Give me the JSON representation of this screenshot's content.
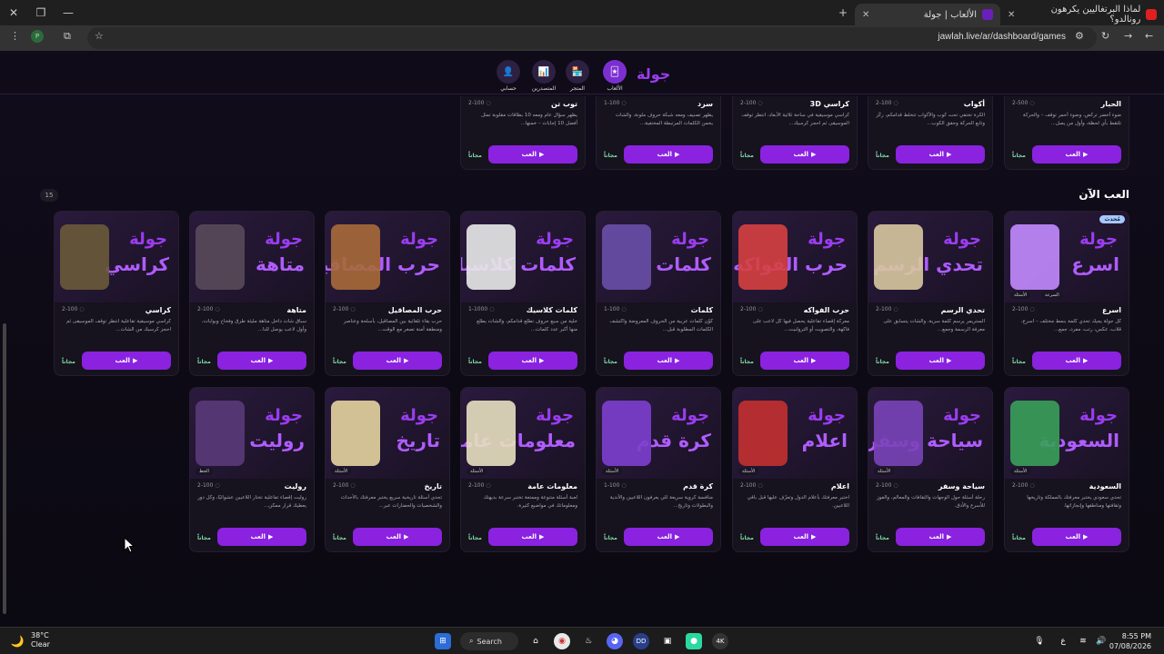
{
  "browser": {
    "tabs": [
      {
        "title": "لماذا البرتغاليين يكرهون رونالدو؟",
        "active": false
      },
      {
        "title": "الألعاب | جولة",
        "active": true
      }
    ],
    "new_tab": "+",
    "url": "jawlah.live/ar/dashboard/games"
  },
  "nav": {
    "logo": "جولة",
    "items": [
      {
        "label": "الألعاب",
        "icon": "game-icon",
        "active": true
      },
      {
        "label": "المتجر",
        "icon": "store-icon",
        "active": false
      },
      {
        "label": "المتصدرين",
        "icon": "leaderboard-icon",
        "active": false
      },
      {
        "label": "حسابي",
        "icon": "profile-icon",
        "active": false
      }
    ]
  },
  "common": {
    "play_label": "العب",
    "free_label": "مجاناً",
    "play_icon": "▶",
    "users_icon": "👥"
  },
  "top_row": [
    {
      "name": "الحبار",
      "players": "2-500",
      "desc": "ضوء أخضر تركض، وضوء أحمر توقف – والحركة تلتقط بأي لحظة، وأول من يصل..."
    },
    {
      "name": "أكواب",
      "players": "2-100",
      "desc": "الكرة تختفي تحت كوب والأكواب تتخلط قدامكم، ركّز وتابع الحركة وحقق الكوب..."
    },
    {
      "name": "كراسي 3D",
      "players": "2-100",
      "desc": "كراسي موسيقية في ساحة ثلاثية الأبعاد، انتظر توقف الموسيقى ثم احجز كرسيك..."
    },
    {
      "name": "سرد",
      "players": "1-100",
      "desc": "يظهر تصنيف ومعه شبكة حروف ملونة، والشات يخمن الكلمات المرتبطة المختفية..."
    },
    {
      "name": "توب تن",
      "players": "2-100",
      "desc": "يظهر سؤال عام ومعه 10 بطاقات مقلوبة تمثل أفضل 10 إجابات – خمنها..."
    }
  ],
  "section": {
    "title": "العب الآن",
    "count": "15"
  },
  "row1": [
    {
      "name": "اسرع",
      "players": "2-100",
      "desc": "كل جولة يجيك تحدي كلمة بنمط مختلف – اسرع، قلاب، عكس، رتب، مفرد، جمع...",
      "thumb_title": "اسرع",
      "new": "مُحدث",
      "badges": [
        "الأسئلة",
        "السرعة"
      ]
    },
    {
      "name": "تحدي الرسم",
      "players": "2-100",
      "desc": "الستريمر يرسم كلمة سرية، والشات يتسابق على معرفة الرسمة وجمع...",
      "thumb_title": "تحدي الرسم",
      "new": "",
      "badges": []
    },
    {
      "name": "حرب الفواكه",
      "players": "2-100",
      "desc": "معركة إقصاء تفاعلية يحصل فيها كل لاعب على فاكهة، والتصويت أو الترولنيت...",
      "thumb_title": "حرب الفواكه",
      "new": "",
      "badges": []
    },
    {
      "name": "كلمات",
      "players": "1-100",
      "desc": "كوّن كلمات عربية من الحروف المعروضة واكتشف الكلمات المطلوبة قبل...",
      "thumb_title": "كلمات",
      "new": "",
      "badges": []
    },
    {
      "name": "كلمات كلاسيك",
      "players": "1-1000",
      "desc": "خلية من سبع حروف تطلع قدامكم، والشات يطلع منها أكبر عدد كلمات...",
      "thumb_title": "كلمات كلاسيك",
      "new": "",
      "badges": []
    },
    {
      "name": "حرب المصاقيل",
      "players": "2-100",
      "desc": "حرب بقاء تلقائية بين المصاقيل، بأسلحة وعناصر ومنطقة آمنة تصغر مع الوقت...",
      "thumb_title": "حرب المصاقيل",
      "new": "",
      "badges": []
    },
    {
      "name": "متاهة",
      "players": "2-100",
      "desc": "سباق شات داخل متاهة مليئة طرق وفخاخ وبوابات، وأول لاعب يوصل للنا...",
      "thumb_title": "متاهة",
      "new": "",
      "badges": []
    },
    {
      "name": "كراسي",
      "players": "2-100",
      "desc": "كراسي موسيقية تفاعلية انتظر توقف الموسيقى ثم احجز كرسيك من الشات...",
      "thumb_title": "كراسي",
      "new": "",
      "badges": []
    }
  ],
  "row2": [
    {
      "name": "السعودية",
      "players": "2-100",
      "desc": "تحدي سعودي يختبر معرفتك بالمملكة وتاريخها وثقافتها ومناطقها وإنجازاتها.",
      "thumb_title": "السعودية",
      "badges": [
        "الأسئلة"
      ]
    },
    {
      "name": "سياحة وسفر",
      "players": "2-100",
      "desc": "رحلة أسئلة حول الوجهات والثقافات والمعالم، والفوز للأسرع والأدق.",
      "thumb_title": "سياحة وسفر",
      "badges": [
        "الأسئلة"
      ]
    },
    {
      "name": "اعلام",
      "players": "2-100",
      "desc": "اختبر معرفتك بأعلام الدول وتعرّف عليها قبل باقي اللاعبين.",
      "thumb_title": "اعلام",
      "badges": [
        "الأسئلة"
      ]
    },
    {
      "name": "كرة قدم",
      "players": "1-100",
      "desc": "منافسة كروية سريعة للي يعرفون اللاعبين والأندية والبطولات وتاريخ...",
      "thumb_title": "كرة قدم",
      "badges": [
        "الأسئلة"
      ]
    },
    {
      "name": "معلومات عامة",
      "players": "2-100",
      "desc": "لعبة أسئلة متنوعة وممتعة تختبر سرعة بديهتك ومعلوماتك في مواضيع كثيرة.",
      "thumb_title": "معلومات عامة",
      "badges": [
        "الأسئلة"
      ]
    },
    {
      "name": "تاريخ",
      "players": "2-100",
      "desc": "تحدي أسئلة تاريخية سريع يختبر معرفتك بالأحداث والشخصيات والحضارات عبر...",
      "thumb_title": "تاريخ",
      "badges": [
        "الأسئلة"
      ]
    },
    {
      "name": "روليت",
      "players": "2-100",
      "desc": "روليت إقصاء تفاعلية تختار اللاعبين عشوائيًا، وكل دور يعطيك قرار ممكن...",
      "thumb_title": "روليت",
      "badges": [
        "الحظ"
      ]
    }
  ],
  "taskbar": {
    "temp": "38°C",
    "weather": "Clear",
    "search": "Search",
    "lang": "ع",
    "time": "8:55 PM",
    "date": "07/08/2026"
  },
  "colors": {
    "accent": "#8a22e0",
    "brand": "#9b3cf0",
    "free": "#7de0a6"
  }
}
